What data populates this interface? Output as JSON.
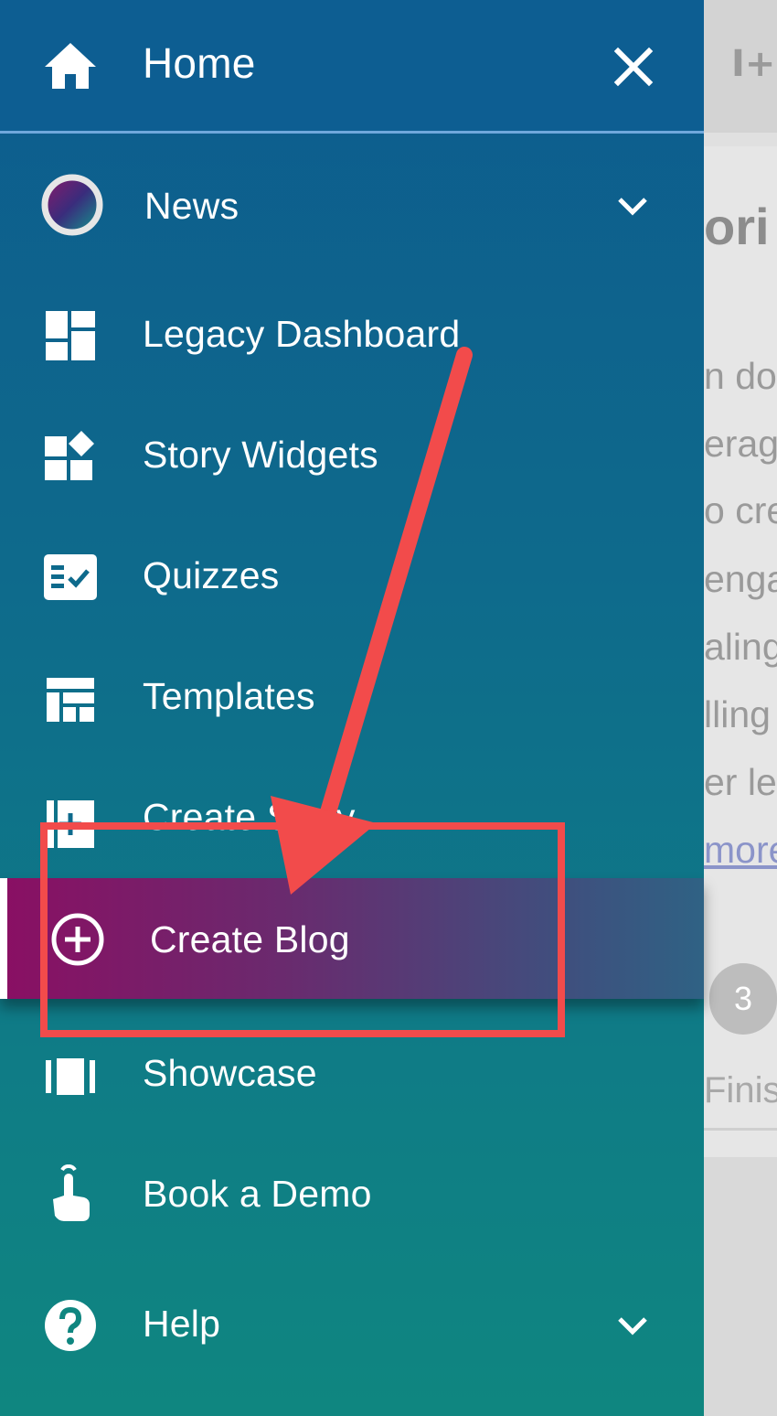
{
  "background": {
    "heading_fragment": "ori",
    "text_fragments": [
      "n dor",
      "erage",
      "o cre",
      "enga",
      "aling",
      "lling",
      "er lea"
    ],
    "link_fragment": "more",
    "step_number": "3",
    "step_label_fragment": "Finis"
  },
  "drawer": {
    "header": {
      "title": "Home",
      "icon": "home-icon",
      "close_icon": "close-icon"
    },
    "items": [
      {
        "label": "News",
        "icon": "news-avatar-icon",
        "expandable": true
      },
      {
        "label": "Legacy Dashboard",
        "icon": "dashboard-icon"
      },
      {
        "label": "Story Widgets",
        "icon": "widgets-icon"
      },
      {
        "label": "Quizzes",
        "icon": "quiz-checklist-icon"
      },
      {
        "label": "Templates",
        "icon": "templates-icon"
      },
      {
        "label": "Create Story",
        "icon": "create-story-icon"
      },
      {
        "label": "Create Blog",
        "icon": "add-circle-icon",
        "active": true
      },
      {
        "label": "Showcase",
        "icon": "showcase-carousel-icon"
      },
      {
        "label": "Book a Demo",
        "icon": "touch-hand-icon"
      },
      {
        "label": "Help",
        "icon": "help-icon",
        "expandable": true
      }
    ]
  },
  "colors": {
    "drawer_top": "#0d5b8e",
    "drawer_bottom": "#0f8680",
    "active_start": "#8a0f63",
    "active_end": "#2f6284",
    "annotation": "#f24b4b"
  }
}
